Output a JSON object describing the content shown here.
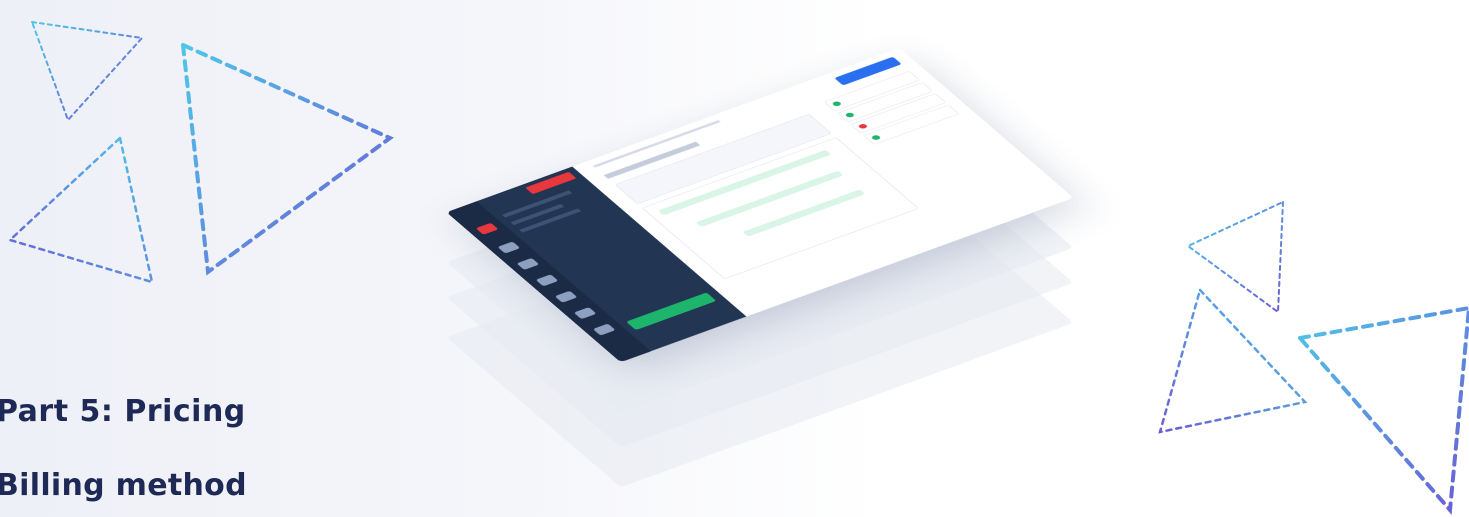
{
  "heading": "Part 5: Pricing",
  "subheading": "Billing method",
  "colors": {
    "heading": "#1e2a55",
    "triangle_blue": "#4fc6e8",
    "triangle_purple": "#6a5cd6",
    "sidebar": "#223553",
    "accent_red": "#e8383d",
    "accent_green": "#1db46b",
    "accent_blue": "#2a6ff0"
  }
}
